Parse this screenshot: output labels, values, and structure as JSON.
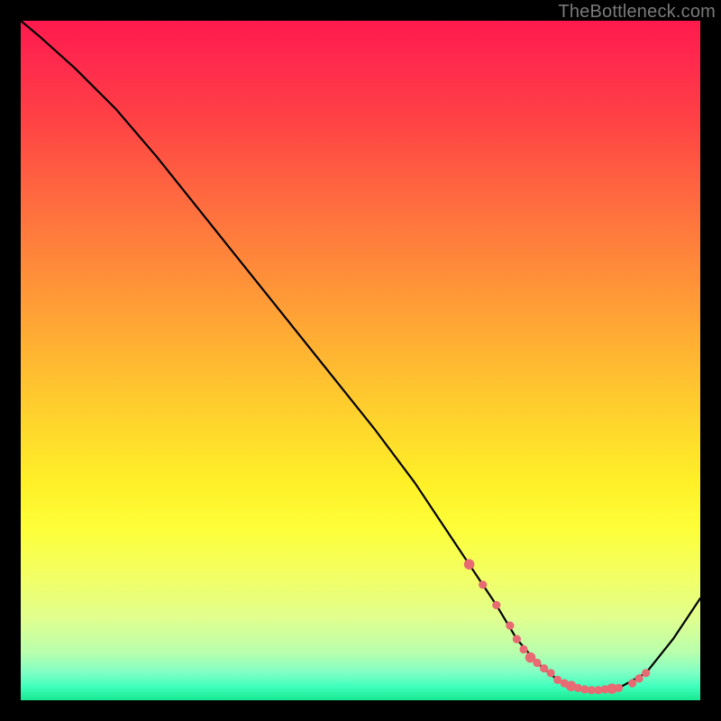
{
  "watermark": "TheBottleneck.com",
  "chart_data": {
    "type": "line",
    "title": "",
    "xlabel": "",
    "ylabel": "",
    "xlim": [
      0,
      100
    ],
    "ylim": [
      0,
      100
    ],
    "grid": false,
    "legend": false,
    "series": [
      {
        "name": "bottleneck-curve",
        "x": [
          0,
          3,
          8,
          14,
          20,
          28,
          36,
          44,
          52,
          58,
          62,
          66,
          70,
          73,
          76,
          79,
          82,
          85,
          88,
          92,
          96,
          100
        ],
        "y": [
          100,
          97.5,
          93,
          87,
          80,
          70,
          60,
          50,
          40,
          32,
          26,
          20,
          14,
          9,
          5.5,
          3,
          1.8,
          1.5,
          1.8,
          4,
          9,
          15
        ]
      }
    ],
    "markers": {
      "name": "flat-region-dots",
      "x": [
        66,
        68,
        70,
        72,
        73,
        74,
        75,
        76,
        77,
        78,
        79,
        80,
        81,
        82,
        83,
        84,
        85,
        86,
        87,
        88,
        90,
        91,
        92
      ],
      "y": [
        20,
        17,
        14,
        11,
        9,
        7.5,
        6.3,
        5.5,
        4.7,
        4,
        3,
        2.5,
        2.1,
        1.8,
        1.6,
        1.5,
        1.5,
        1.6,
        1.7,
        1.8,
        2.5,
        3.2,
        4
      ]
    },
    "colors": {
      "curve": "#000000",
      "marker": "#e86a72",
      "gradient_top": "#ff1a4d",
      "gradient_mid": "#fff028",
      "gradient_bottom": "#18e890"
    }
  }
}
